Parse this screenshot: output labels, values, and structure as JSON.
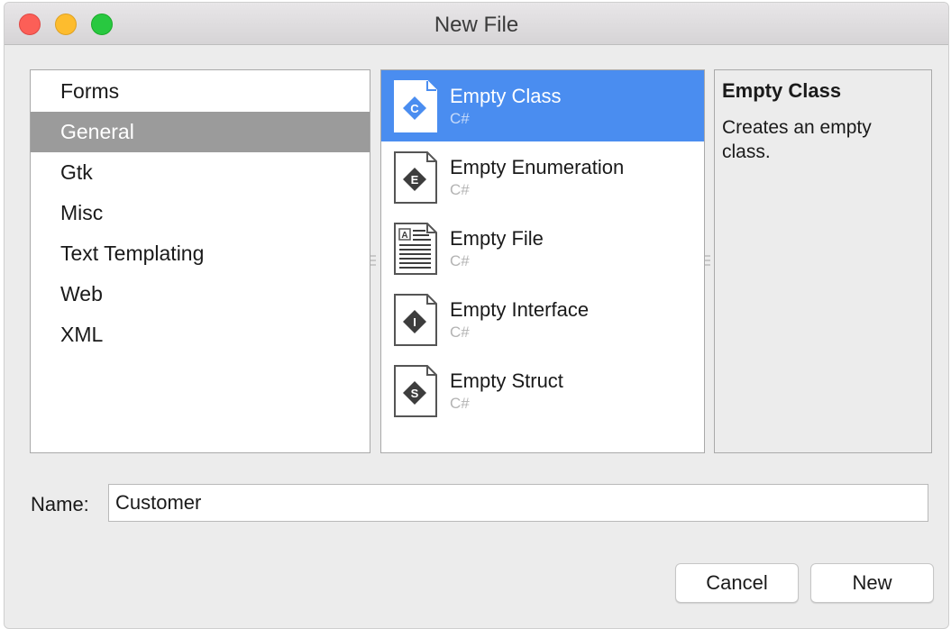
{
  "window": {
    "title": "New File"
  },
  "categories": [
    {
      "label": "Forms",
      "selected": false
    },
    {
      "label": "General",
      "selected": true
    },
    {
      "label": "Gtk",
      "selected": false
    },
    {
      "label": "Misc",
      "selected": false
    },
    {
      "label": "Text Templating",
      "selected": false
    },
    {
      "label": "Web",
      "selected": false
    },
    {
      "label": "XML",
      "selected": false
    }
  ],
  "templates": [
    {
      "name": "Empty Class",
      "lang": "C#",
      "icon": "class-icon",
      "letter": "C",
      "selected": true
    },
    {
      "name": "Empty Enumeration",
      "lang": "C#",
      "icon": "enumeration-icon",
      "letter": "E",
      "selected": false
    },
    {
      "name": "Empty File",
      "lang": "C#",
      "icon": "text-file-icon",
      "letter": "A",
      "selected": false
    },
    {
      "name": "Empty Interface",
      "lang": "C#",
      "icon": "interface-icon",
      "letter": "I",
      "selected": false
    },
    {
      "name": "Empty Struct",
      "lang": "C#",
      "icon": "struct-icon",
      "letter": "S",
      "selected": false
    }
  ],
  "description": {
    "title": "Empty Class",
    "text": "Creates an empty class."
  },
  "name_field": {
    "label": "Name:",
    "value": "Customer"
  },
  "buttons": {
    "cancel": "Cancel",
    "new": "New"
  },
  "colors": {
    "selection_blue": "#4a8df0",
    "category_selected": "#9b9b9b"
  }
}
